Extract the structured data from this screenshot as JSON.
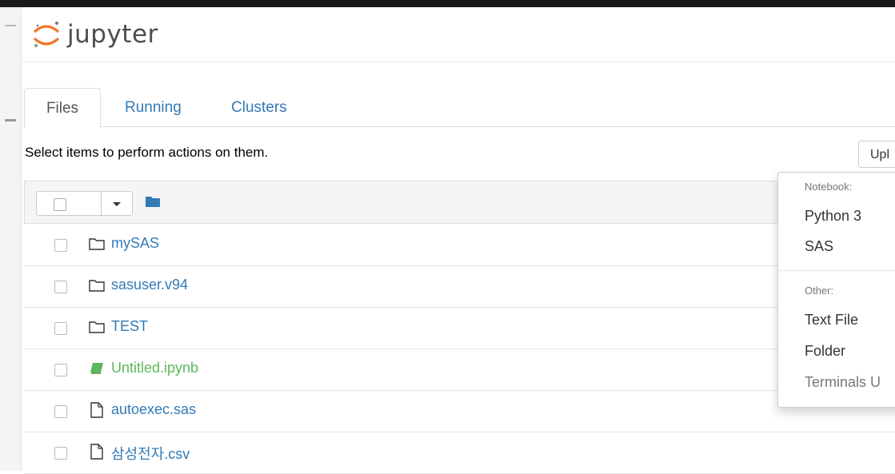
{
  "app": {
    "logo_text": "jupyter",
    "brand_colors": {
      "orange": "#f37626",
      "grey": "#4d4d4d",
      "link": "#337ab7",
      "notebook_green": "#5cb85c"
    }
  },
  "tabs": [
    {
      "label": "Files",
      "active": true
    },
    {
      "label": "Running",
      "active": false
    },
    {
      "label": "Clusters",
      "active": false
    }
  ],
  "instructions": "Select items to perform actions on them.",
  "toolbar": {
    "upload_label": "Upl"
  },
  "files": [
    {
      "name": "mySAS",
      "type": "folder",
      "icon": "folder-icon"
    },
    {
      "name": "sasuser.v94",
      "type": "folder",
      "icon": "folder-icon"
    },
    {
      "name": "TEST",
      "type": "folder",
      "icon": "folder-icon"
    },
    {
      "name": "Untitled.ipynb",
      "type": "notebook",
      "icon": "notebook-icon"
    },
    {
      "name": "autoexec.sas",
      "type": "file",
      "icon": "file-icon"
    },
    {
      "name": "삼성전자.csv",
      "type": "file",
      "icon": "file-icon"
    }
  ],
  "new_menu": {
    "notebook_header": "Notebook:",
    "notebook_items": [
      "Python 3",
      "SAS"
    ],
    "other_header": "Other:",
    "other_items": [
      "Text File",
      "Folder"
    ],
    "terminals": "Terminals U"
  }
}
